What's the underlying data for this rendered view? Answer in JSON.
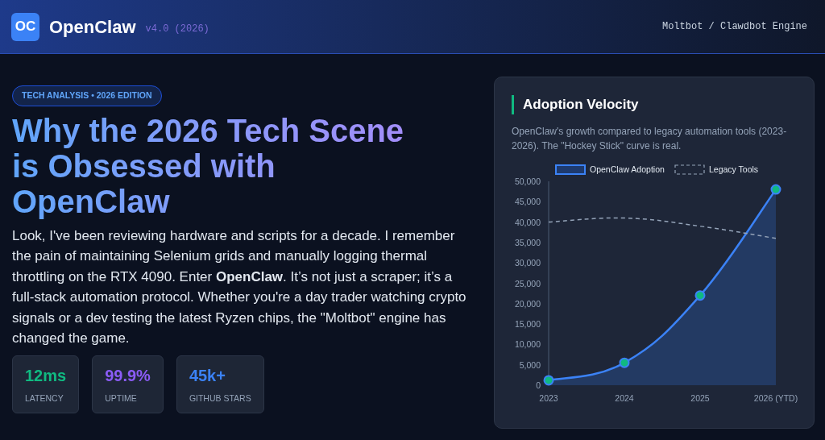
{
  "header": {
    "logo": "OC",
    "brand": "OpenClaw",
    "version": "v4.0 (2026)",
    "tagline": "Moltbot / Clawdbot Engine"
  },
  "hero": {
    "badge": "TECH ANALYSIS • 2026 EDITION",
    "title": "Why the 2026 Tech Scene is Obsessed with OpenClaw",
    "body": "Look, I've been reviewing hardware and scripts for a decade. I remember the pain of maintaining Selenium grids and manually logging thermal throttling on the RTX 4090. Enter **OpenClaw**. It’s not just a scraper; it’s a full-stack automation protocol. Whether you're a day trader watching crypto signals or a dev testing the latest Ryzen chips, the \"Moltbot\" engine has changed the game.",
    "stats": [
      {
        "value": "12ms",
        "label": "LATENCY",
        "color": "#10b981"
      },
      {
        "value": "99.9%",
        "label": "UPTIME",
        "color": "#8b5cf6"
      },
      {
        "value": "45k+",
        "label": "GITHUB STARS",
        "color": "#3b82f6"
      }
    ]
  },
  "chart_card": {
    "title": "Adoption Velocity",
    "description": "OpenClaw's growth compared to legacy automation tools (2023-2026). The \"Hockey Stick\" curve is real.",
    "chart_data": {
      "type": "line",
      "legend": "top",
      "categories": [
        "2023",
        "2024",
        "2025",
        "2026 (YTD)"
      ],
      "ylim": [
        0,
        50000
      ],
      "yticks": [
        {
          "value": 0,
          "label": "0"
        },
        {
          "value": 5000,
          "label": "5,000"
        },
        {
          "value": 10000,
          "label": "10,000"
        },
        {
          "value": 15000,
          "label": "15,000"
        },
        {
          "value": 20000,
          "label": "20,000"
        },
        {
          "value": 25000,
          "label": "25,000"
        },
        {
          "value": 30000,
          "label": "30,000"
        },
        {
          "value": 35000,
          "label": "35,000"
        },
        {
          "value": 40000,
          "label": "40,000"
        },
        {
          "value": 45000,
          "label": "45,000"
        },
        {
          "value": 50000,
          "label": "50,000"
        }
      ],
      "series": [
        {
          "name": "OpenClaw Adoption",
          "color": "#3b82f6",
          "type": "area",
          "marker": "circle",
          "line_style": "solid",
          "values": [
            1200,
            5500,
            22000,
            48000
          ]
        },
        {
          "name": "Legacy Tools",
          "color": "#94a3b8",
          "marker": "none",
          "line_style": "dashed",
          "values": [
            40000,
            41000,
            39000,
            36000
          ]
        }
      ]
    }
  }
}
